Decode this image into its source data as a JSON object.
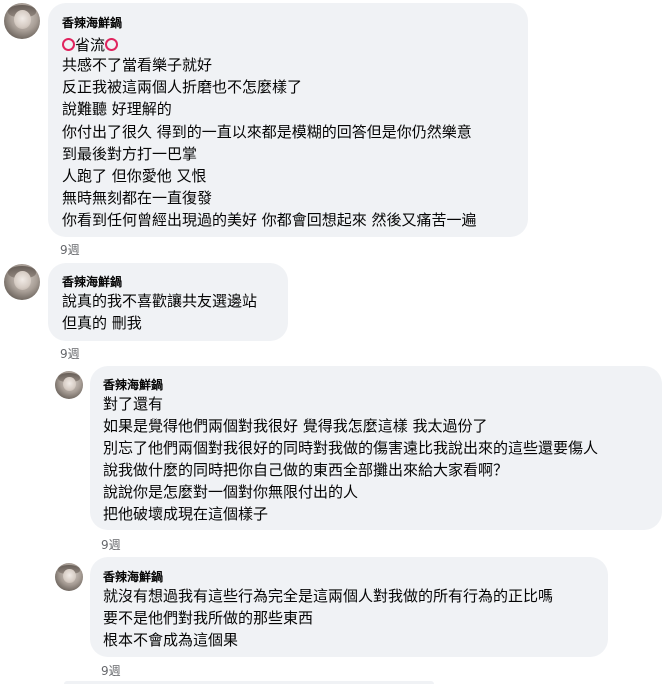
{
  "comments": [
    {
      "author": "香辣海鮮鍋",
      "lines": [
        "省流",
        "共感不了當看樂子就好",
        "反正我被這兩個人折磨也不怎麼樣了",
        "說難聽 好理解的",
        "你付出了很久 得到的一直以來都是模糊的回答但是你仍然樂意",
        "到最後對方打一巴掌",
        "人跑了 但你愛他 又恨",
        "無時無刻都在一直復發",
        "你看到任何曾經出現過的美好 你都會回想起來 然後又痛苦一遍"
      ],
      "title_emoji": "red-hollow-circle",
      "time": "9週"
    },
    {
      "author": "香辣海鮮鍋",
      "lines": [
        "說真的我不喜歡讓共友選邊站",
        "但真的 刪我"
      ],
      "time": "9週"
    },
    {
      "author": "香辣海鮮鍋",
      "lines": [
        "對了還有",
        "如果是覺得他們兩個對我很好 覺得我怎麼這樣 我太過份了",
        "別忘了他們兩個對我很好的同時對我做的傷害遠比我說出來的這些還要傷人",
        "說我做什麼的同時把你自己做的東西全部攤出來給大家看啊？",
        "說說你是怎麼對一個對你無限付出的人",
        "把他破壞成現在這個樣子"
      ],
      "time": "9週"
    },
    {
      "author": "香辣海鮮鍋",
      "lines": [
        "就沒有想過我有這些行為完全是這兩個人對我做的所有行為的正比嗎",
        "要不是他們對我所做的那些東西",
        "根本不會成為這個果"
      ],
      "time": "9週"
    }
  ],
  "colors": {
    "bubble": "#f0f2f5",
    "text": "#050505",
    "meta": "#65676b",
    "emoji_circle": "#e0245e"
  }
}
